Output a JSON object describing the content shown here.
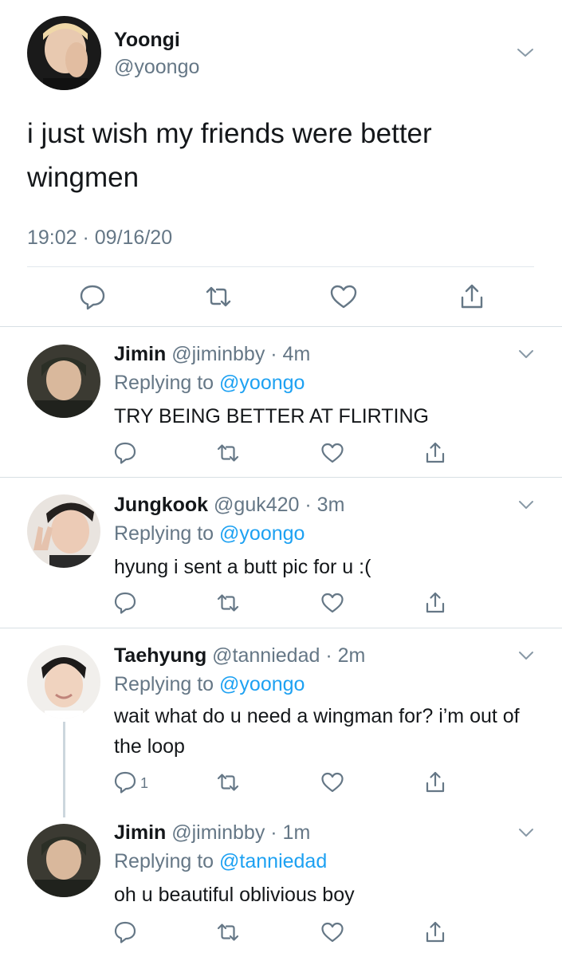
{
  "main_tweet": {
    "name": "Yoongi",
    "handle": "@yoongo",
    "text": "i just wish my friends were better wingmen",
    "timestamp": "19:02 · 09/16/20",
    "actions": [
      "reply-icon",
      "retweet-icon",
      "like-icon",
      "share-icon"
    ]
  },
  "replies": [
    {
      "name": "Jimin",
      "handle": "@jiminbby",
      "time": "· 4m",
      "replying_prefix": "Replying to ",
      "replying_to": "@yoongo",
      "text": "TRY BEING BETTER AT FLIRTING",
      "reply_count": ""
    },
    {
      "name": "Jungkook",
      "handle": "@guk420",
      "time": "· 3m",
      "replying_prefix": "Replying to ",
      "replying_to": "@yoongo",
      "text": "hyung i sent a butt pic for u :(",
      "reply_count": ""
    },
    {
      "name": "Taehyung",
      "handle": "@tanniedad",
      "time": "· 2m",
      "replying_prefix": "Replying to ",
      "replying_to": "@yoongo",
      "text": "wait what do u need a wingman for? i’m out of the loop",
      "reply_count": "1"
    },
    {
      "name": "Jimin",
      "handle": "@jiminbby",
      "time": "· 1m",
      "replying_prefix": "Replying to ",
      "replying_to": "@tanniedad",
      "text": "oh u beautiful oblivious boy",
      "reply_count": ""
    }
  ],
  "colors": {
    "text": "#14171a",
    "secondary": "#657786",
    "link": "#1da1f2",
    "divider": "#e1e8ed"
  }
}
